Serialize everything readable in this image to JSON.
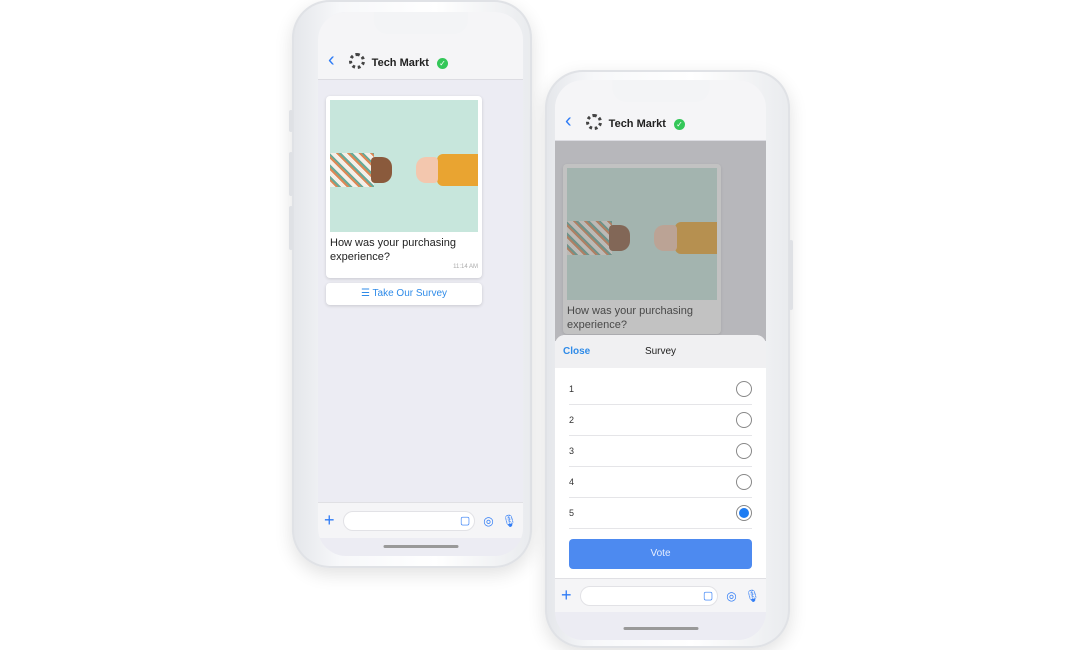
{
  "chat": {
    "contact_name": "Tech Markt",
    "verified_icon": "check-circle-icon",
    "message": {
      "text": "How was your purchasing experience?",
      "time": "11:14 AM",
      "image": "thumbs-down-thumbs-up-hands"
    },
    "survey_button_label": "Take Our Survey"
  },
  "survey_sheet": {
    "close_label": "Close",
    "title": "Survey",
    "options": [
      {
        "label": "1",
        "selected": false
      },
      {
        "label": "2",
        "selected": false
      },
      {
        "label": "3",
        "selected": false
      },
      {
        "label": "4",
        "selected": false
      },
      {
        "label": "5",
        "selected": true
      }
    ],
    "vote_label": "Vote"
  },
  "colors": {
    "accent": "#2f7cf6",
    "vote_button": "#4d8af0",
    "verified": "#34c759"
  }
}
